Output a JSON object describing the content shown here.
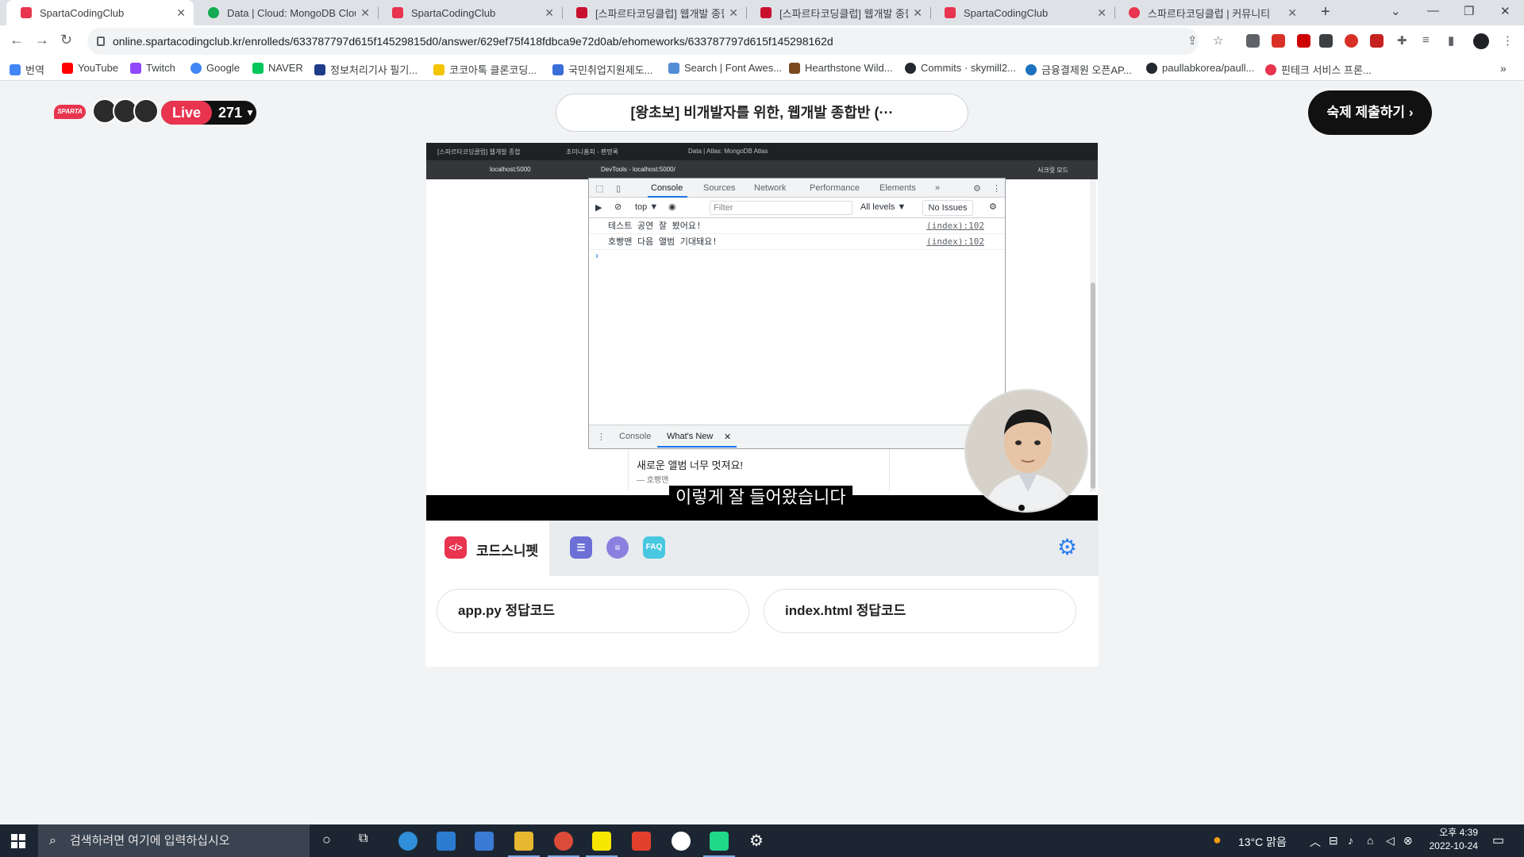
{
  "browser": {
    "tabs": [
      {
        "title": "SpartaCodingClub",
        "color": "#e8344e",
        "active": true
      },
      {
        "title": "Data | Cloud: MongoDB Cloud",
        "color": "#13aa52"
      },
      {
        "title": "SpartaCodingClub",
        "color": "#e8344e"
      },
      {
        "title": "[스파르타코딩클럽] 웹개발 종합",
        "color": "#c8102e"
      },
      {
        "title": "[스파르타코딩클럽] 웹개발 종합",
        "color": "#c8102e"
      },
      {
        "title": "SpartaCodingClub",
        "color": "#e8344e"
      },
      {
        "title": "스파르타코딩클럽 | 커뮤니티",
        "color": "#e8344e"
      }
    ],
    "url": "online.spartacodingclub.kr/enrolleds/633787797d615f14529815d0/answer/629ef75f418fdbca9e72d0ab/ehomeworks/633787797d615f145298162d",
    "bookmarks": [
      {
        "label": "번역",
        "color": "#4285f4"
      },
      {
        "label": "YouTube",
        "color": "#ff0000"
      },
      {
        "label": "Twitch",
        "color": "#9146ff"
      },
      {
        "label": "Google",
        "color": "#4285f4"
      },
      {
        "label": "NAVER",
        "color": "#03c75a"
      },
      {
        "label": "정보처리기사 필기...",
        "color": "#1f3c88"
      },
      {
        "label": "코코아톡 클론코딩...",
        "color": "#f5c400"
      },
      {
        "label": "국민취업지원제도...",
        "color": "#3b6fd8"
      },
      {
        "label": "Search | Font Awes...",
        "color": "#538dd7"
      },
      {
        "label": "Hearthstone Wild...",
        "color": "#7a4a1e"
      },
      {
        "label": "Commits · skymill2...",
        "color": "#24292f"
      },
      {
        "label": "금융결제원 오픈AP...",
        "color": "#1e73be"
      },
      {
        "label": "paullabkorea/paull...",
        "color": "#24292f"
      },
      {
        "label": "핀테크 서비스 프론...",
        "color": "#e8344e"
      }
    ]
  },
  "header": {
    "live_label": "Live",
    "live_count": "271",
    "course_title": "[왕초보] 비개발자를 위한, 웹개발 종합반 (···",
    "submit_label": "숙제 제출하기"
  },
  "video": {
    "inner_tabs": [
      "[스파르타코딩클럽] 웹개발 종합",
      "초미니홈피 - 팬명록",
      "Data | Atlas: MongoDB Atlas"
    ],
    "inner_url": "localhost:5000",
    "devtools_title": "DevTools - localhost:5000/",
    "inner_profile": "시크릿 모드",
    "devtools": {
      "tabs": [
        "Console",
        "Sources",
        "Network",
        "Performance",
        "Elements"
      ],
      "context": "top",
      "filter_placeholder": "Filter",
      "levels": "All levels ▼",
      "issues": "No Issues",
      "logs": [
        {
          "text": "테스트 공연 잘 봤어요!",
          "source": "(index):102"
        },
        {
          "text": "호빵맨 다음 앨범 기대돼요!",
          "source": "(index):102"
        }
      ],
      "drawer_tabs": [
        "Console",
        "What's New"
      ]
    },
    "comment_text": "새로운 앨범 너무 멋져요!",
    "comment_author": "— 호빵맨",
    "subtitle": "이렇게 잘 들어왔습니다"
  },
  "panel": {
    "active_tab": "코드스니펫",
    "faq_label": "FAQ",
    "snippets": [
      "app.py 정답코드",
      "index.html 정답코드"
    ]
  },
  "taskbar": {
    "search_placeholder": "검색하려면 여기에 입력하십시오",
    "weather": "13°C 맑음",
    "time": "오후 4:39",
    "date": "2022-10-24"
  }
}
